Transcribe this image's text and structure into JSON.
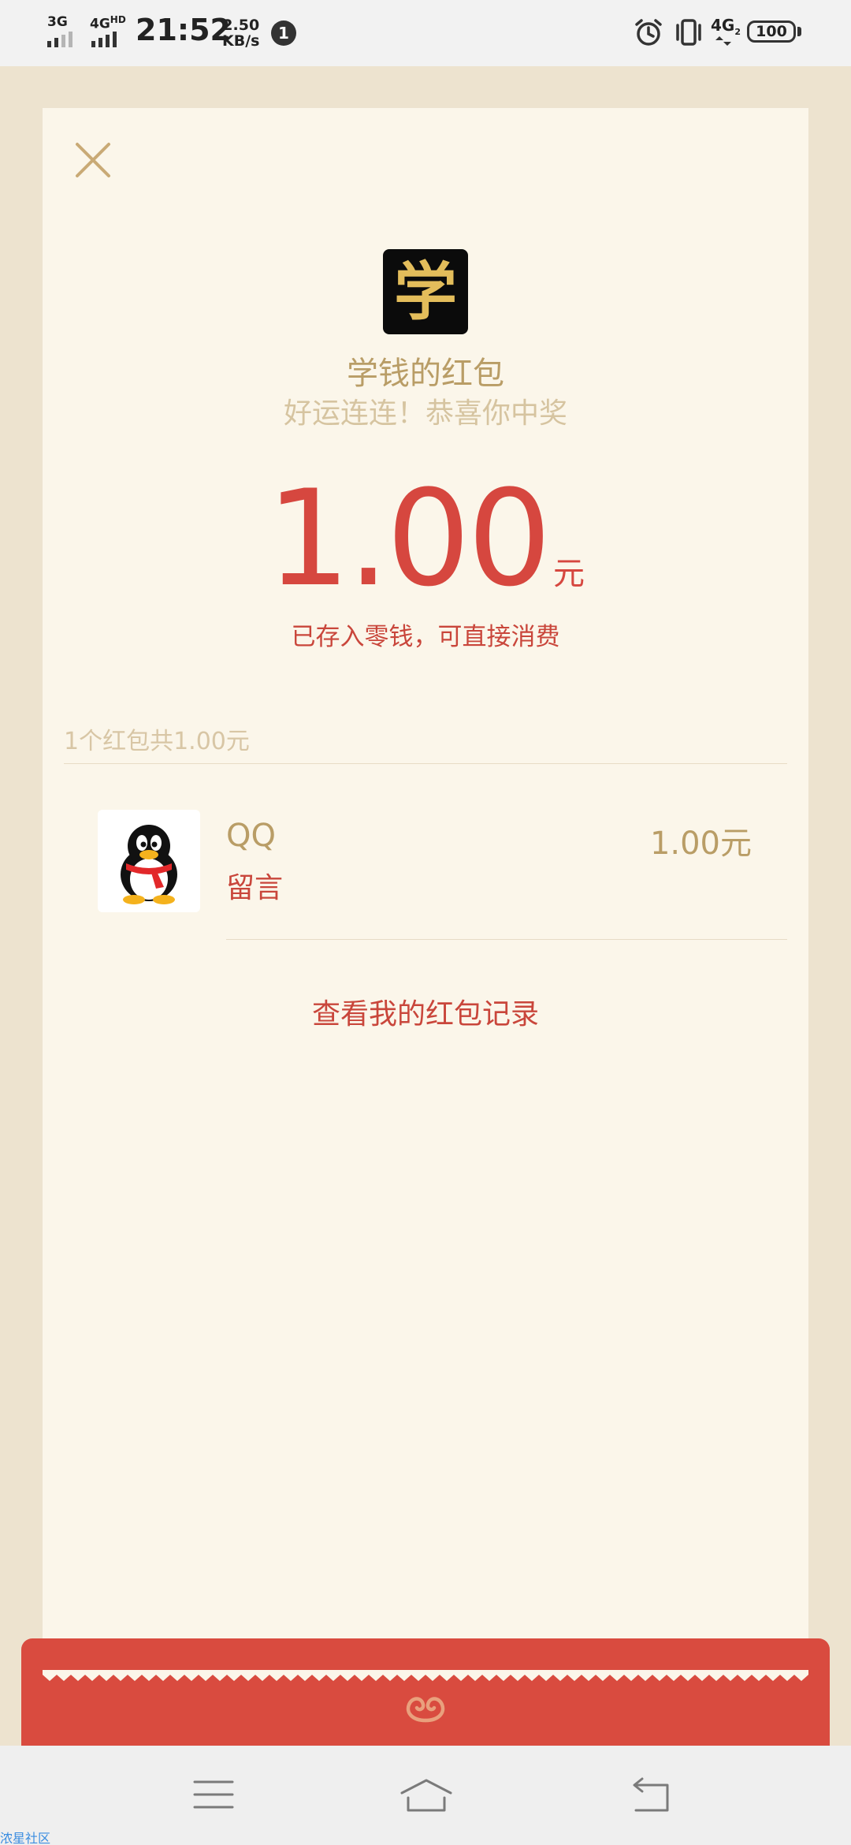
{
  "status_bar": {
    "sim1_label": "3G",
    "sim2_label": "4G",
    "sim2_hd": "HD",
    "time": "21:52",
    "speed_value": "2.50",
    "speed_unit": "KB/s",
    "notification_count": "1",
    "net_label": "4G",
    "net_sub": "2",
    "battery": "100"
  },
  "card": {
    "logo_char": "学",
    "title": "学钱的红包",
    "subtitle": "好运连连！恭喜你中奖",
    "amount": "1.00",
    "amount_unit": "元",
    "saved_note": "已存入零钱，可直接消费",
    "summary": "1个红包共1.00元",
    "sender": {
      "name": "QQ",
      "message": "留言",
      "amount": "1.00元"
    },
    "records_link": "查看我的红包记录"
  },
  "watermark": "浓星社区",
  "colors": {
    "accent_red": "#d6473f",
    "gold_text": "#b99d66",
    "card_bg": "#fbf6ea",
    "page_bg": "#ede3cf"
  },
  "icons": {
    "close": "close-icon",
    "menu": "menu-icon",
    "home": "home-icon",
    "back": "back-icon",
    "alarm": "alarm-icon",
    "vibrate": "vibrate-icon"
  }
}
